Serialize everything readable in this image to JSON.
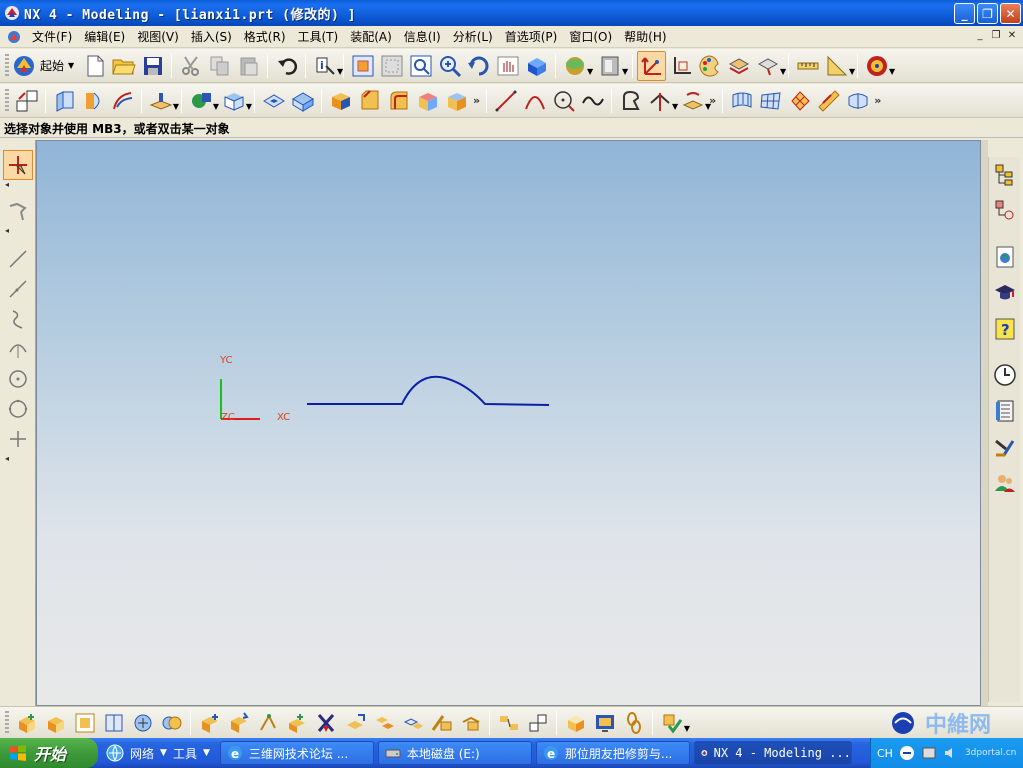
{
  "window": {
    "title": "NX 4 - Modeling - [lianxi1.prt  (修改的) ]"
  },
  "menu": {
    "items": [
      "文件(F)",
      "编辑(E)",
      "视图(V)",
      "插入(S)",
      "格式(R)",
      "工具(T)",
      "装配(A)",
      "信息(I)",
      "分析(L)",
      "首选项(P)",
      "窗口(O)",
      "帮助(H)"
    ]
  },
  "toolbar": {
    "start_label": "起始"
  },
  "prompt": {
    "text": "选择对象并使用 MB3，或者双击某一对象"
  },
  "graphics": {
    "axes": {
      "x_label": "XC",
      "y_label": "YC",
      "z_label": "ZC"
    },
    "colors": {
      "x_axis": "#e31a1a",
      "y_axis": "#17c117",
      "z_axis": "#e31a1a",
      "curve": "#0a1fa8",
      "label": "#d9441e"
    }
  },
  "taskbar": {
    "start_label": "开始",
    "quick_items": [
      "网络",
      "工具"
    ],
    "tasks": [
      "三维网技术论坛 ...",
      "本地磁盘 (E:)",
      "那位朋友把修剪与...",
      "NX 4 - Modeling ..."
    ],
    "tray_label": "CH",
    "watermark": "3dportal.cn"
  }
}
